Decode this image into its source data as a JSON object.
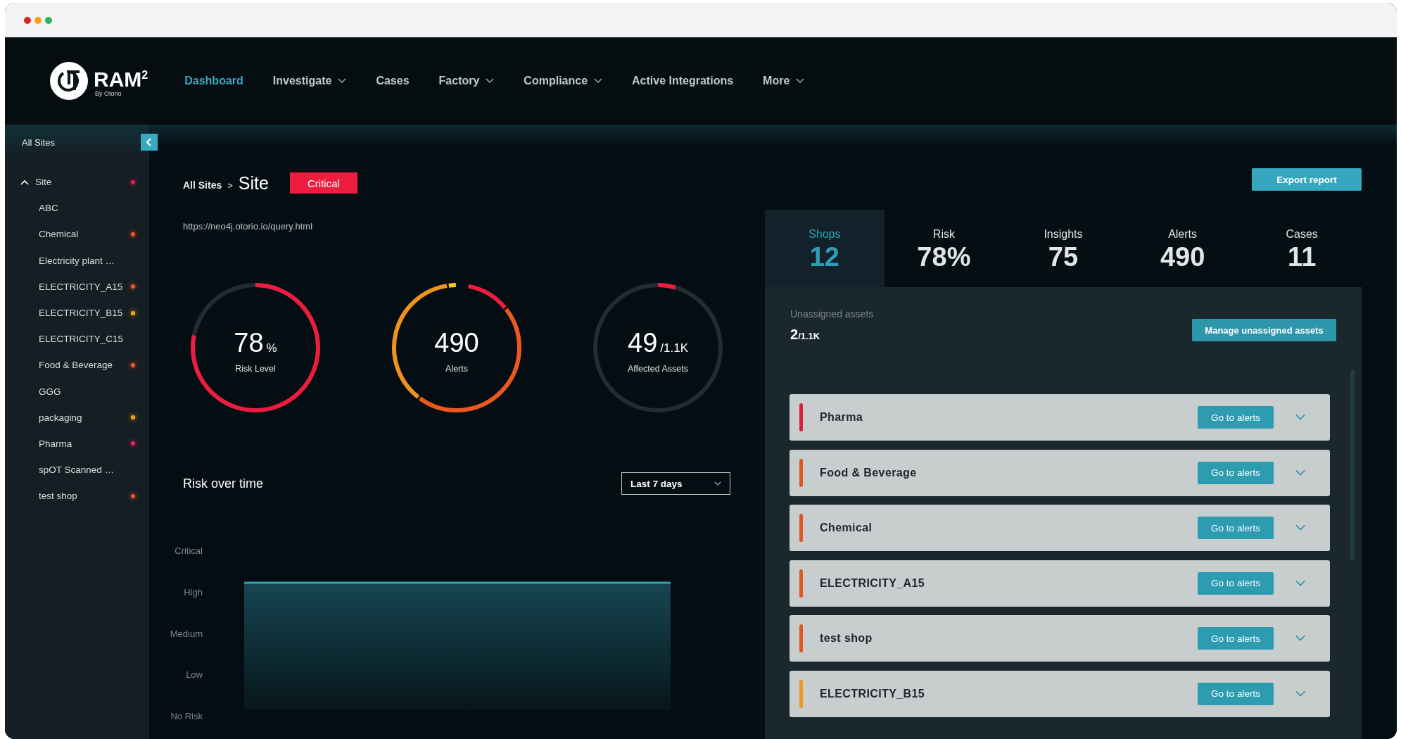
{
  "nav": {
    "logo": {
      "name": "RAM$^{2}$",
      "tagline": "By Otorio"
    },
    "items": [
      {
        "label": "Dashboard",
        "selected": true,
        "has_menu": false
      },
      {
        "label": "Investigate",
        "selected": false,
        "has_menu": true
      },
      {
        "label": "Cases",
        "selected": false,
        "has_menu": false
      },
      {
        "label": "Factory",
        "selected": false,
        "has_menu": true
      },
      {
        "label": "Compliance",
        "selected": false,
        "has_menu": true
      },
      {
        "label": "Active Integrations",
        "selected": false,
        "has_menu": false
      },
      {
        "label": "More",
        "selected": false,
        "has_menu": true
      }
    ]
  },
  "sidebar": {
    "header": "All Sites",
    "tree": [
      {
        "label": "Site",
        "expanded": true,
        "color": "#e8194a",
        "children": [
          {
            "label": "ABC"
          },
          {
            "label": "Chemical",
            "color": "#f0552a"
          },
          {
            "label": "Electricity plant …"
          },
          {
            "label": "ELECTRICITY_A15",
            "color": "#f0552a"
          },
          {
            "label": "ELECTRICITY_B15",
            "color": "#f5a623"
          },
          {
            "label": "ELECTRICITY_C15"
          },
          {
            "label": "Food & Beverage",
            "color": "#f0552a"
          },
          {
            "label": "GGG"
          },
          {
            "label": "packaging",
            "color": "#f5a623"
          },
          {
            "label": "Pharma",
            "color": "#e8245a"
          },
          {
            "label": "spOT Scanned …"
          },
          {
            "label": "test shop",
            "color": "#f0552a"
          }
        ]
      }
    ]
  },
  "breadcrumb": {
    "parent": "All Sites",
    "separator": ">",
    "current": "Site"
  },
  "status_badge": "Critical",
  "url": "https://neo4j.otorio.io/query.html",
  "gauges": [
    {
      "kind": "meter",
      "value": "78",
      "unit": "%",
      "label": "Risk Level",
      "color": "#ee1c3e",
      "level": 0.78
    },
    {
      "kind": "breakdown",
      "value": "490",
      "label": "Alerts"
    },
    {
      "kind": "meter",
      "value": "49",
      "unit": "/1.1K",
      "label": "Affected Assets",
      "color": "#ee1c3e",
      "level": 0.045
    }
  ],
  "risk_over_time": {
    "title": "Risk over time",
    "range": "Last 7 days",
    "axis_labels": [
      "Critical",
      "High",
      "Medium",
      "Low",
      "No Risk"
    ]
  },
  "export_button": "Export report",
  "summary_tabs": [
    {
      "label": "Shops",
      "value": "12",
      "selected": true
    },
    {
      "label": "Risk",
      "value": "78%",
      "selected": false
    },
    {
      "label": "Insights",
      "value": "75",
      "selected": false
    },
    {
      "label": "Alerts",
      "value": "490",
      "selected": false
    },
    {
      "label": "Cases",
      "value": "11",
      "selected": false
    }
  ],
  "unassigned": {
    "label": "Unassigned assets",
    "count": "2",
    "total": "/1.1K",
    "button": "Manage unassigned assets"
  },
  "shops": [
    {
      "name": "Pharma",
      "color": "#d8203e",
      "button": "Go to alerts"
    },
    {
      "name": "Food & Beverage",
      "color": "#e0561e",
      "button": "Go to alerts"
    },
    {
      "name": "Chemical",
      "color": "#e0561e",
      "button": "Go to alerts"
    },
    {
      "name": "ELECTRICITY_A15",
      "color": "#e0561e",
      "button": "Go to alerts"
    },
    {
      "name": "test shop",
      "color": "#e0561e",
      "button": "Go to alerts"
    },
    {
      "name": "ELECTRICITY_B15",
      "color": "#f0961e",
      "button": "Go to alerts"
    }
  ]
}
